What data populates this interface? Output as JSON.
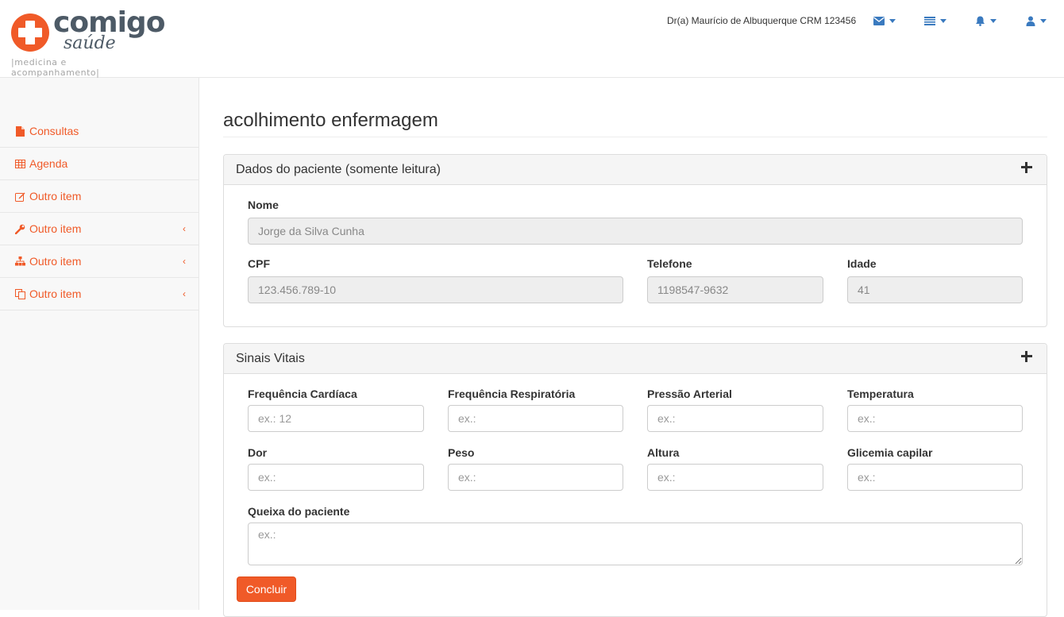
{
  "brand": {
    "name": "comigo",
    "sub": "saúde",
    "tagline": "|medicina e acompanhamento|",
    "accent": "#f05a28",
    "nav_color": "#3a7abf"
  },
  "header": {
    "user": "Dr(a) Maurício de Albuquerque CRM 123456",
    "icons": [
      "envelope-icon",
      "list-icon",
      "bell-icon",
      "user-icon"
    ]
  },
  "sidebar": {
    "items": [
      {
        "label": "Consultas",
        "icon": "file-icon"
      },
      {
        "label": "Agenda",
        "icon": "table-icon"
      },
      {
        "label": "Outro item",
        "icon": "edit-icon"
      },
      {
        "label": "Outro item",
        "icon": "wrench-icon",
        "chevron": "‹"
      },
      {
        "label": "Outro item",
        "icon": "sitemap-icon",
        "chevron": "‹"
      },
      {
        "label": "Outro item",
        "icon": "copy-icon",
        "chevron": "‹"
      }
    ]
  },
  "page": {
    "title": "acolhimento enfermagem"
  },
  "patient_panel": {
    "heading": "Dados do paciente (somente leitura)",
    "nome_label": "Nome",
    "nome_value": "Jorge da Silva Cunha",
    "cpf_label": "CPF",
    "cpf_value": "123.456.789-10",
    "telefone_label": "Telefone",
    "telefone_value": "1198547-9632",
    "idade_label": "Idade",
    "idade_value": "41"
  },
  "vitals_panel": {
    "heading": "Sinais Vitais",
    "fields": [
      {
        "label": "Frequência Cardíaca",
        "placeholder": "ex.: 12"
      },
      {
        "label": "Frequência Respiratória",
        "placeholder": "ex.:"
      },
      {
        "label": "Pressão Arterial",
        "placeholder": "ex.:"
      },
      {
        "label": "Temperatura",
        "placeholder": "ex.:"
      },
      {
        "label": "Dor",
        "placeholder": "ex.:"
      },
      {
        "label": "Peso",
        "placeholder": "ex.:"
      },
      {
        "label": "Altura",
        "placeholder": "ex.:"
      },
      {
        "label": "Glicemia capilar",
        "placeholder": "ex.:"
      }
    ],
    "queixa_label": "Queixa do paciente",
    "queixa_placeholder": "ex.:",
    "submit_label": "Concluir"
  }
}
